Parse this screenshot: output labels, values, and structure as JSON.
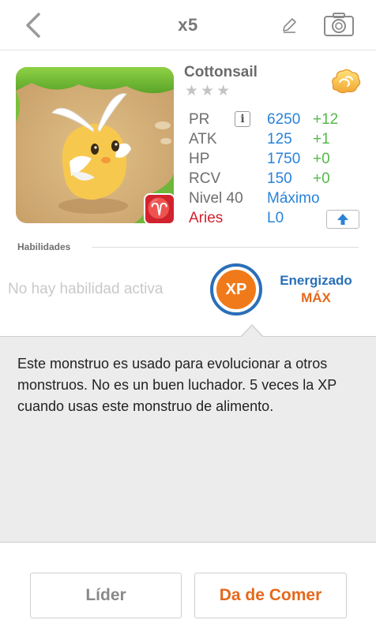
{
  "header": {
    "title": "x5",
    "back_icon": "chevron-left-icon",
    "edit_icon": "pencil-icon",
    "camera_icon": "camera-icon"
  },
  "monster": {
    "name": "Cottonsail",
    "stars_total": 3,
    "stars_filled": 0,
    "image_icon": "monster-portrait",
    "element_symbol": "♈",
    "type_icon": "cloud-type-icon",
    "stats": [
      {
        "label": "PR",
        "value": "6250",
        "bonus": "+12"
      },
      {
        "label": "ATK",
        "value": "125",
        "bonus": "+1"
      },
      {
        "label": "HP",
        "value": "1750",
        "bonus": "+0"
      },
      {
        "label": "RCV",
        "value": "150",
        "bonus": "+0"
      },
      {
        "label": "Nivel 40",
        "value": "Máximo",
        "bonus": ""
      },
      {
        "label": "Aries",
        "value": "L0",
        "bonus": ""
      }
    ],
    "info_label": "i"
  },
  "skills": {
    "section_label": "Habilidades",
    "empty_text": "No hay habilidad activa",
    "xp_badge_label": "XP",
    "energized_label": "Energizado",
    "energized_level": "MÁX"
  },
  "description": {
    "text": "Este monstruo es usado para evolucionar a otros monstruos. No es un buen luchador. 5 veces la XP cuando usas este monstruo de alimento."
  },
  "actions": {
    "leader_label": "Líder",
    "feed_label": "Da de Comer"
  },
  "colors": {
    "blue_value": "#2a83d9",
    "green_bonus": "#54b949",
    "accent_orange": "#e4691d",
    "element_red": "#d2212f"
  }
}
